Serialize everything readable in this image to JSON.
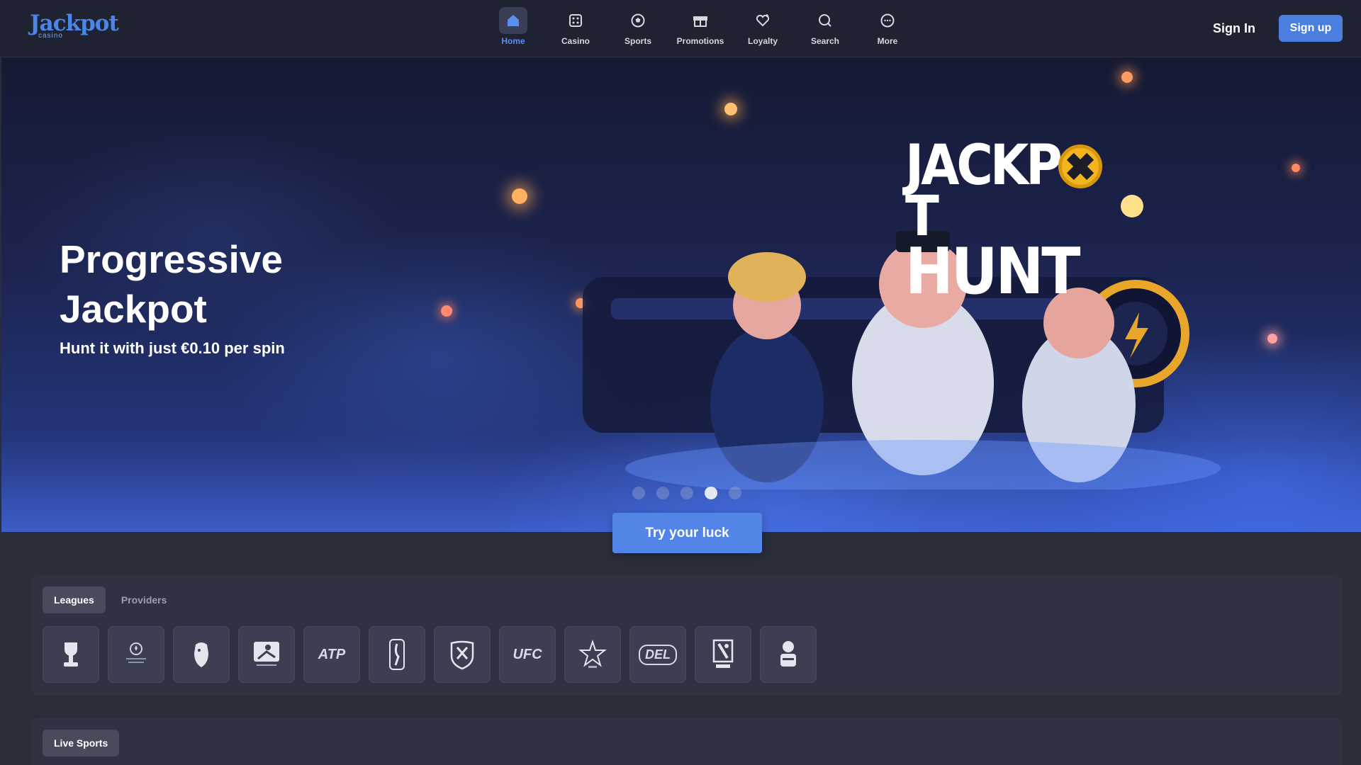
{
  "brand": {
    "logo_word": "Jackpot",
    "logo_sub": "casino"
  },
  "nav": {
    "items": [
      {
        "label": "Home",
        "icon": "home-icon",
        "active": true
      },
      {
        "label": "Casino",
        "icon": "dice-icon"
      },
      {
        "label": "Sports",
        "icon": "soccer-ball-icon"
      },
      {
        "label": "Promotions",
        "icon": "gift-icon"
      },
      {
        "label": "Loyalty",
        "icon": "heart-icon"
      },
      {
        "label": "Search",
        "icon": "search-icon"
      },
      {
        "label": "More",
        "icon": "more-icon"
      }
    ]
  },
  "auth": {
    "sign_in": "Sign In",
    "sign_up": "Sign up"
  },
  "hero": {
    "title": "Progressive Jackpot",
    "subtitle": "Hunt it with just €0.10 per spin",
    "art_title_line1": "JACKP",
    "art_title_line1_end": "T",
    "art_title_line2": "HUNT",
    "cta": "Try your luck",
    "slides_count": 5,
    "active_slide": 4
  },
  "leagues_panel": {
    "tabs": [
      {
        "label": "Leagues",
        "active": true
      },
      {
        "label": "Providers"
      }
    ],
    "leagues": [
      {
        "name": "trophy-logo"
      },
      {
        "name": "champions-league-logo"
      },
      {
        "name": "premier-league-logo"
      },
      {
        "name": "bundesliga-logo"
      },
      {
        "name": "atp-logo",
        "text": "ATP"
      },
      {
        "name": "nba-logo"
      },
      {
        "name": "nfl-logo"
      },
      {
        "name": "ufc-logo",
        "text": "UFC"
      },
      {
        "name": "star-league-logo"
      },
      {
        "name": "del-logo",
        "text": "DEL"
      },
      {
        "name": "handball-league-logo"
      },
      {
        "name": "basketball-league-logo"
      }
    ]
  },
  "live_panel": {
    "tab": "Live Sports"
  },
  "colors": {
    "accent": "#4a7fe0",
    "header_bg": "#1f2230",
    "page_bg": "#2a2d3a"
  }
}
